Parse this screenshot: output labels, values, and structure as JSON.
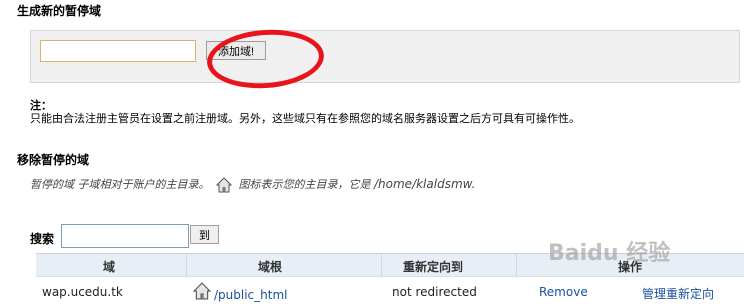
{
  "create_section": {
    "title": "生成新的暂停域",
    "domain_value": "",
    "add_button": "添加域!"
  },
  "note": {
    "title": "注：",
    "text": "只能由合法注册主管员在设置之前注册域。另外，这些域只有在参照您的域名服务器设置之后方可具有可操作性。"
  },
  "remove_section": {
    "title": "移除暂停的域",
    "info_prefix": "暂停的域 子域相对于账户的主目录。",
    "info_middle": "图标表示您的主目录，它是",
    "home_path": "/home/klaldsmw."
  },
  "search": {
    "label": "搜索",
    "value": "",
    "button": "到"
  },
  "table": {
    "headers": [
      "域",
      "域根",
      "重新定向到",
      "操作"
    ],
    "rows": [
      {
        "domain": "wap.ucedu.tk",
        "root": "/public_html",
        "redirect": "not redirected",
        "remove": "Remove",
        "manage": "管理重新定向"
      }
    ]
  },
  "watermark": "Baidu 经验",
  "colors": {
    "annotation_circle": "#e8141b",
    "link": "#1a4f9c",
    "header_bg": "#e8eef6"
  }
}
